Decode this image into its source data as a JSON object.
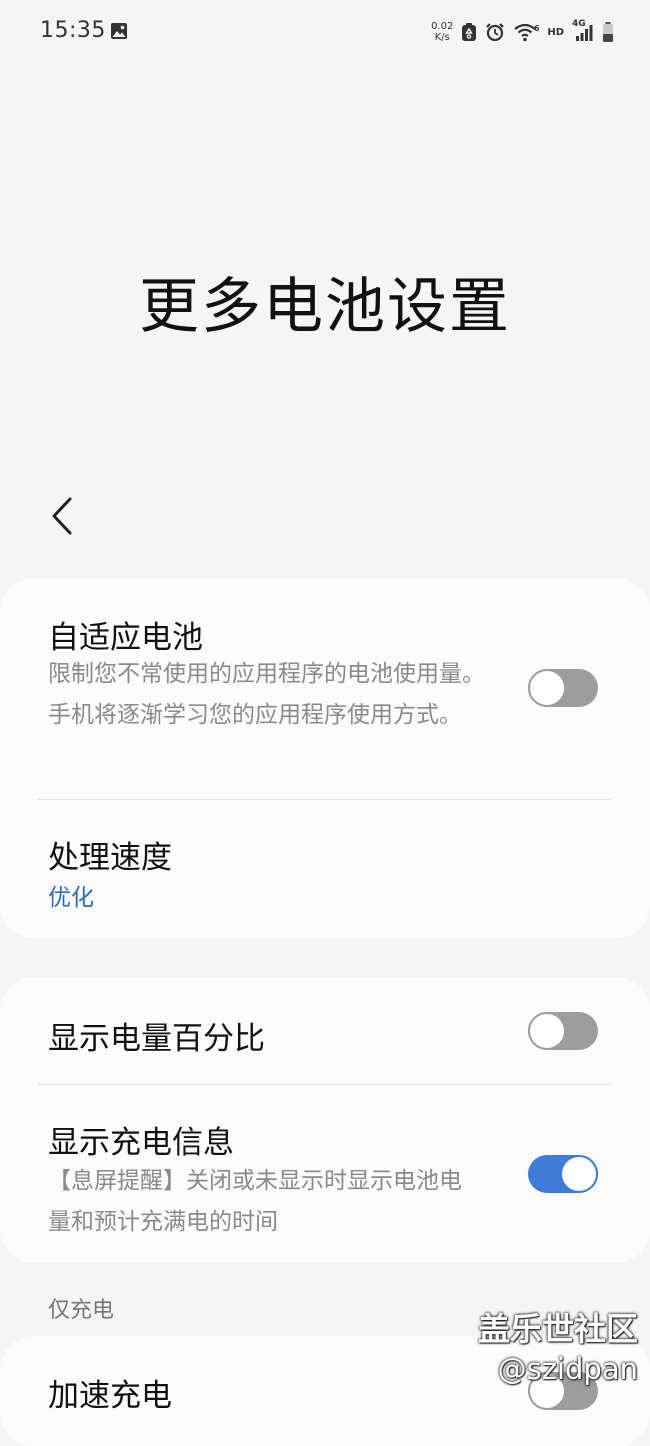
{
  "status_bar": {
    "time": "15:35",
    "net_speed_value": "0.02",
    "net_speed_unit": "K/s",
    "hd_label": "HD",
    "network_type": "4G"
  },
  "page": {
    "title": "更多电池设置"
  },
  "card1": {
    "adaptive": {
      "title": "自适应电池",
      "subtitle": "限制您不常使用的应用程序的电池使用量。手机将逐渐学习您的应用程序使用方式。",
      "enabled": false
    },
    "processing": {
      "title": "处理速度",
      "value": "优化"
    }
  },
  "card2": {
    "percentage": {
      "title": "显示电量百分比",
      "enabled": false
    },
    "charging_info": {
      "title": "显示充电信息",
      "subtitle": "【息屏提醒】关闭或未显示时显示电池电量和预计充满电的时间",
      "enabled": true
    }
  },
  "section_charging": {
    "header": "仅充电",
    "fast_charging": {
      "title": "加速充电",
      "enabled": false
    }
  },
  "watermark": {
    "main": "盖乐世社区",
    "sub": "@szidpan"
  },
  "colors": {
    "accent": "#3f7bd9",
    "value_text": "#2d6bbf",
    "toggle_off": "#9d9d9d",
    "background": "#f5f5f5",
    "card": "#fcfcfc"
  }
}
